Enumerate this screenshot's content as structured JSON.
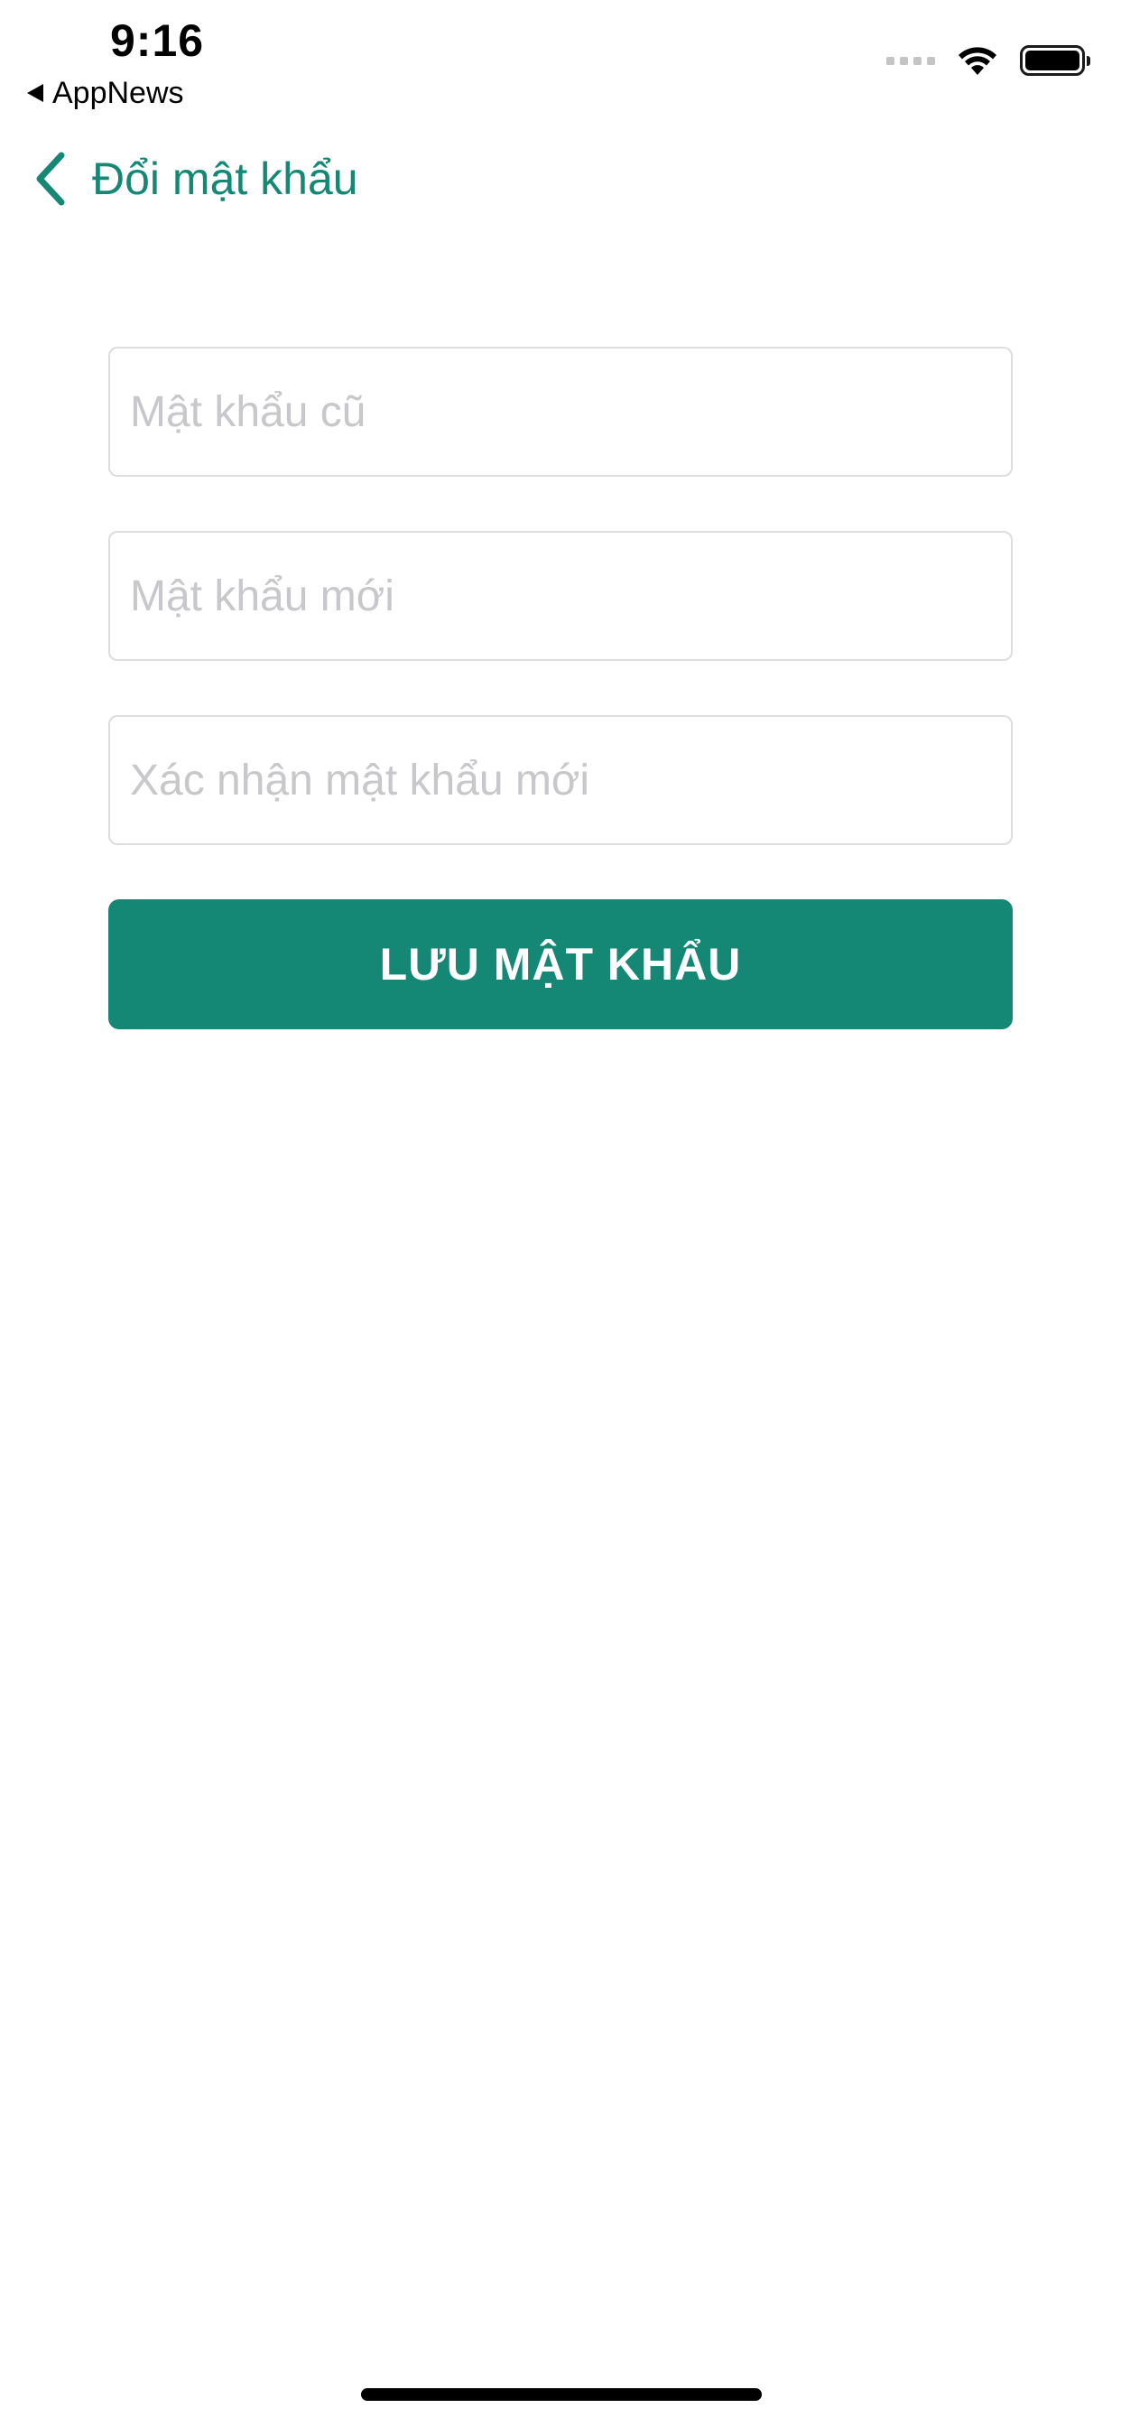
{
  "status_bar": {
    "time": "9:16",
    "back_app_label": "AppNews",
    "icons": [
      "cellular-signal-icon",
      "wifi-icon",
      "battery-icon"
    ]
  },
  "nav": {
    "back_icon": "chevron-left-icon",
    "title": "Đổi mật khẩu"
  },
  "form": {
    "old_password": {
      "value": "",
      "placeholder": "Mật khẩu cũ"
    },
    "new_password": {
      "value": "",
      "placeholder": "Mật khẩu mới"
    },
    "confirm_password": {
      "value": "",
      "placeholder": "Xác nhận mật khẩu mới"
    },
    "save_label": "LƯU MẬT KHẨU"
  },
  "colors": {
    "accent": "#158775",
    "placeholder": "#c7c7cc",
    "field_border": "#dddddd"
  }
}
